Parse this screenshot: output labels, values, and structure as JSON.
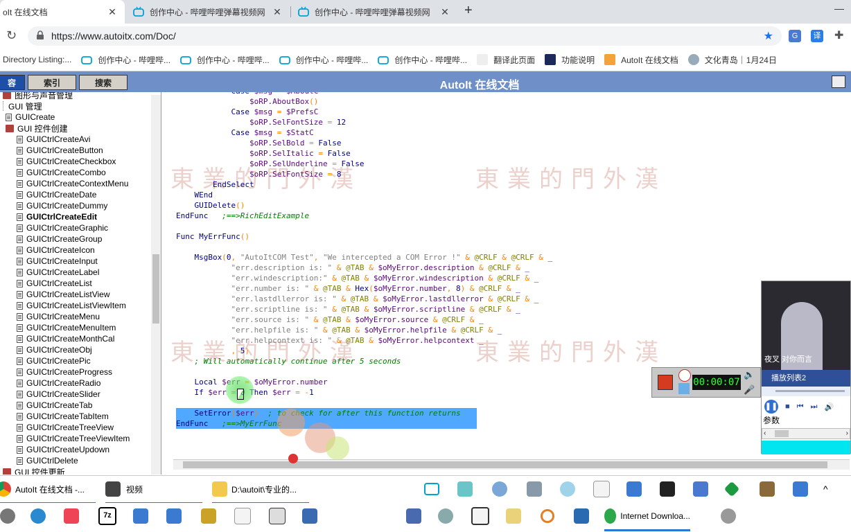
{
  "browser": {
    "tabs": [
      {
        "label": "oIt 在线文档",
        "active": true
      },
      {
        "label": "创作中心 - 哔哩哔哩弹幕视频网",
        "active": false
      },
      {
        "label": "创作中心 - 哔哩哔哩弹幕视频网",
        "active": false
      }
    ],
    "new_tab": "+",
    "minimize": "—",
    "url": "https://www.autoitx.com/Doc/",
    "bookmarks": [
      "Directory Listing:...",
      "创作中心 - 哔哩哔...",
      "创作中心 - 哔哩哔...",
      "创作中心 - 哔哩哔...",
      "创作中心 - 哔哩哔...",
      "翻译此页面",
      "功能说明",
      "AutoIt 在线文档",
      "文化青岛｜1月24日"
    ]
  },
  "help": {
    "tabs": [
      "容",
      "索引",
      "搜索"
    ],
    "title": "AutoIt 在线文档",
    "tree": [
      {
        "label": "图形与声音管理",
        "type": "book",
        "indent": 0
      },
      {
        "label": "GUI 管理",
        "type": "line",
        "indent": 0
      },
      {
        "label": "GUICreate",
        "type": "page",
        "indent": 1
      },
      {
        "label": "GUI 控件创建",
        "type": "book",
        "indent": 1
      },
      {
        "label": "GUICtrlCreateAvi",
        "type": "page",
        "indent": 2
      },
      {
        "label": "GUICtrlCreateButton",
        "type": "page",
        "indent": 2
      },
      {
        "label": "GUICtrlCreateCheckbox",
        "type": "page",
        "indent": 2
      },
      {
        "label": "GUICtrlCreateCombo",
        "type": "page",
        "indent": 2
      },
      {
        "label": "GUICtrlCreateContextMenu",
        "type": "page",
        "indent": 2
      },
      {
        "label": "GUICtrlCreateDate",
        "type": "page",
        "indent": 2
      },
      {
        "label": "GUICtrlCreateDummy",
        "type": "page",
        "indent": 2
      },
      {
        "label": "GUICtrlCreateEdit",
        "type": "page",
        "indent": 2,
        "bold": true
      },
      {
        "label": "GUICtrlCreateGraphic",
        "type": "page",
        "indent": 2
      },
      {
        "label": "GUICtrlCreateGroup",
        "type": "page",
        "indent": 2
      },
      {
        "label": "GUICtrlCreateIcon",
        "type": "page",
        "indent": 2
      },
      {
        "label": "GUICtrlCreateInput",
        "type": "page",
        "indent": 2
      },
      {
        "label": "GUICtrlCreateLabel",
        "type": "page",
        "indent": 2
      },
      {
        "label": "GUICtrlCreateList",
        "type": "page",
        "indent": 2
      },
      {
        "label": "GUICtrlCreateListView",
        "type": "page",
        "indent": 2
      },
      {
        "label": "GUICtrlCreateListViewItem",
        "type": "page",
        "indent": 2
      },
      {
        "label": "GUICtrlCreateMenu",
        "type": "page",
        "indent": 2
      },
      {
        "label": "GUICtrlCreateMenuItem",
        "type": "page",
        "indent": 2
      },
      {
        "label": "GUICtrlCreateMonthCal",
        "type": "page",
        "indent": 2
      },
      {
        "label": "GUICtrlCreateObj",
        "type": "page",
        "indent": 2
      },
      {
        "label": "GUICtrlCreatePic",
        "type": "page",
        "indent": 2
      },
      {
        "label": "GUICtrlCreateProgress",
        "type": "page",
        "indent": 2
      },
      {
        "label": "GUICtrlCreateRadio",
        "type": "page",
        "indent": 2
      },
      {
        "label": "GUICtrlCreateSlider",
        "type": "page",
        "indent": 2
      },
      {
        "label": "GUICtrlCreateTab",
        "type": "page",
        "indent": 2
      },
      {
        "label": "GUICtrlCreateTabItem",
        "type": "page",
        "indent": 2
      },
      {
        "label": "GUICtrlCreateTreeView",
        "type": "page",
        "indent": 2
      },
      {
        "label": "GUICtrlCreateTreeViewItem",
        "type": "page",
        "indent": 2
      },
      {
        "label": "GUICtrlCreateUpdown",
        "type": "page",
        "indent": 2
      },
      {
        "label": "GUICtrlDelete",
        "type": "page",
        "indent": 2
      },
      {
        "label": "GUI 控件更新",
        "type": "book",
        "indent": 0
      }
    ],
    "code_lines": [
      "            Case $msg = $AboutC",
      "                $oRP.AboutBox()",
      "            Case $msg = $PrefsC",
      "                $oRP.SelFontSize = 12",
      "            Case $msg = $StatC",
      "                $oRP.SelBold = False",
      "                $oRP.SelItalic = False",
      "                $oRP.SelUnderline = False",
      "                $oRP.SelFontSize = 8",
      "        EndSelect",
      "    WEnd",
      "    GUIDelete()",
      "EndFunc   ;==>RichEditExample",
      "",
      "Func MyErrFunc()",
      "",
      "    MsgBox(0, \"AutoItCOM Test\", \"We intercepted a COM Error !\" & @CRLF & @CRLF & _",
      "            \"err.description is: \" & @TAB & $oMyError.description & @CRLF & _",
      "            \"err.windescription:\" & @TAB & $oMyError.windescription & @CRLF & _",
      "            \"err.number is: \" & @TAB & Hex($oMyError.number, 8) & @CRLF & _",
      "            \"err.lastdllerror is: \" & @TAB & $oMyError.lastdllerror & @CRLF & _",
      "            \"err.scriptline is: \" & @TAB & $oMyError.scriptline & @CRLF & _",
      "            \"err.source is: \" & @TAB & $oMyError.source & @CRLF & _",
      "            \"err.helpfile is: \" & @TAB & $oMyError.helpfile & @CRLF & _",
      "            \"err.helpcontext is: \" & @TAB & $oMyError.helpcontext _",
      "            , 5)",
      "    ; Will automatically continue after 5 seconds",
      "",
      "    Local $err = $oMyError.number",
      "    If $err = 0 Then $err = -1",
      "",
      "    SetError($err)  ; to check for after this function returns",
      "EndFunc   ;==>MyErrFunc"
    ],
    "watermark": "東業的門外漢"
  },
  "player": {
    "subtitle": "夜叉   对你而言",
    "playlist_label": "播放列表2",
    "params_label": "参数"
  },
  "recorder": {
    "timer": "00:00:07"
  },
  "taskbar": {
    "row1": [
      {
        "label": "AutoIt 在线文档 -...",
        "icon": "chrome-icon"
      },
      {
        "label": "视频",
        "icon": "video-folder-icon"
      },
      {
        "label": "D:\\autoit\\专业的...",
        "icon": "folder-icon"
      }
    ],
    "row2_named": [
      {
        "label": "Internet Downloa...",
        "icon": "idm-icon"
      }
    ],
    "row2_text_icons": [
      "7z"
    ],
    "tray_chevron": "^"
  },
  "colors": {
    "help_header": "#6f8fc8",
    "selection": "#3399ff",
    "cyan_bar": "#00e5f0"
  }
}
